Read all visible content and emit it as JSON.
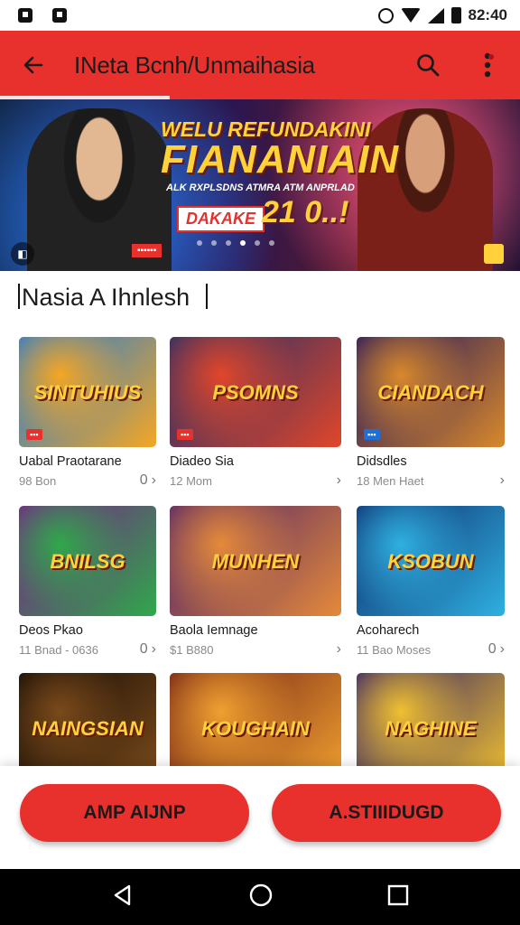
{
  "status_bar": {
    "time": "82:40"
  },
  "app_bar": {
    "title": "INeta Bcnh/Unmaihasia"
  },
  "banner": {
    "headline_1": "WELU REFUNDAKINI",
    "headline_2": "FIANANIAIN",
    "subline": "ALK RXPLSDNS ATMRA ATM ANPRLAD",
    "badge": "DAKAKE",
    "number": "21 0..!"
  },
  "section": {
    "title": "Nasia A Ihnlesh"
  },
  "games": [
    {
      "title": "Uabal Praotarane",
      "meta": "98 Bon",
      "meta_right": "0",
      "logo": "SINTUHIUS",
      "colors": [
        "#1f7ad8",
        "#f5a623"
      ]
    },
    {
      "title": "Diadeo Sia",
      "meta": "12 Mom",
      "meta_right": "",
      "logo": "PSOMNS",
      "colors": [
        "#1a2d6a",
        "#e0462b"
      ]
    },
    {
      "title": "Didsdles",
      "meta": "18 Men Haet",
      "meta_right": "",
      "logo": "CIANDACH",
      "colors": [
        "#1a1060",
        "#d9892b"
      ]
    },
    {
      "title": "Deos Pkao",
      "meta": "11 Bnad - 0636",
      "meta_right": "0",
      "logo": "BNILSG",
      "colors": [
        "#7a1e8a",
        "#2fa84a"
      ]
    },
    {
      "title": "Baola Iemnage",
      "meta": "$1 B880",
      "meta_right": "",
      "logo": "MUNHEN",
      "colors": [
        "#4a1e6a",
        "#e58a3a"
      ]
    },
    {
      "title": "Acoharech",
      "meta": "11 Bao Moses",
      "meta_right": "0",
      "logo": "KSOBUN",
      "colors": [
        "#0d2a6a",
        "#2fb0e0"
      ]
    },
    {
      "title": "",
      "meta": "",
      "meta_right": "",
      "logo": "NAINGSIAN",
      "colors": [
        "#120a06",
        "#7a4a1a"
      ]
    },
    {
      "title": "",
      "meta": "",
      "meta_right": "",
      "logo": "KOUGHAIN",
      "colors": [
        "#6a1a12",
        "#f0a030"
      ]
    },
    {
      "title": "",
      "meta": "",
      "meta_right": "",
      "logo": "NAGHINE",
      "colors": [
        "#2a1a6a",
        "#f0c030"
      ]
    }
  ],
  "actions": {
    "primary": "AMP AIJNP",
    "secondary": "A.STIIIDUGD"
  },
  "colors": {
    "accent": "#e8312c"
  }
}
